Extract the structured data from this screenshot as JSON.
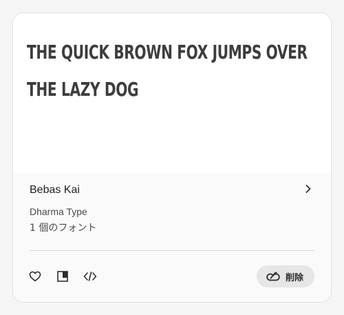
{
  "card": {
    "preview_text": "THE QUICK BROWN FOX JUMPS OVER THE LAZY DOG",
    "font_name": "Bebas Kai",
    "foundry": "Dharma Type",
    "font_count": "1 個のフォント",
    "remove_label": "削除"
  },
  "icons": {
    "chevron": "chevron-right-icon",
    "favorite": "heart-icon",
    "compare": "compare-icon",
    "embed": "code-icon",
    "creative_cloud": "creative-cloud-icon"
  },
  "colors": {
    "card_bg": "#ffffff",
    "info_bg": "#fafafa",
    "button_bg": "#e6e6e6",
    "text": "#2c2c2c"
  }
}
